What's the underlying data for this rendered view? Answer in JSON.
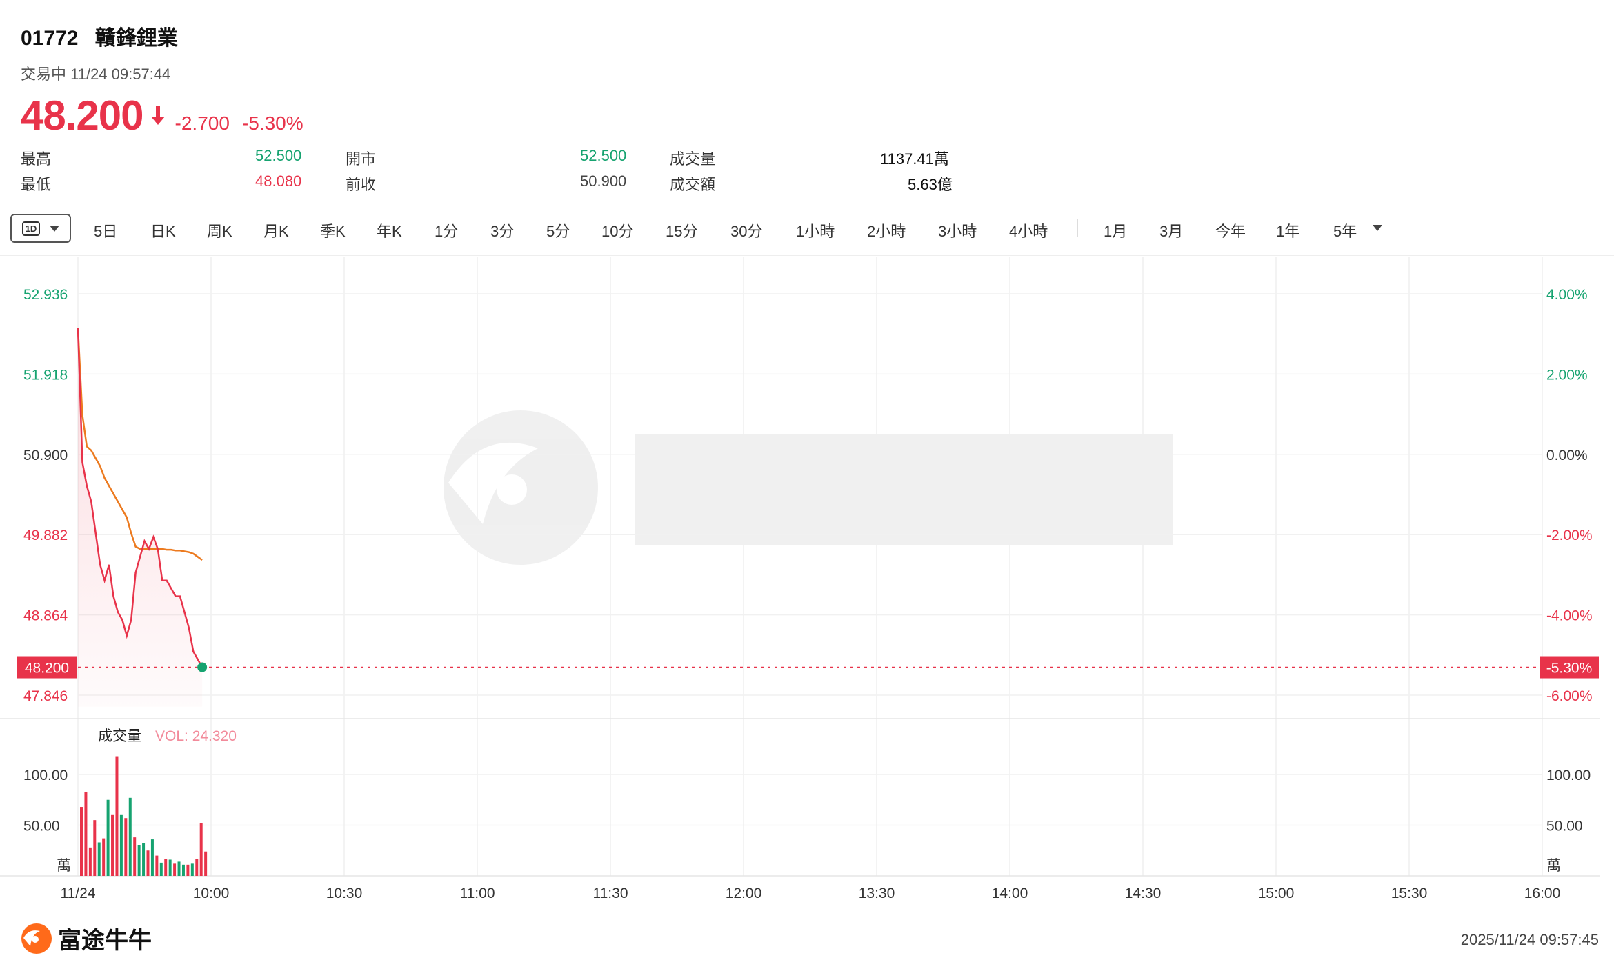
{
  "stock": {
    "code": "01772",
    "name": "贛鋒鋰業",
    "status": "交易中 11/24 09:57:44",
    "price": "48.200",
    "change": "-2.700",
    "change_pct": "-5.30%"
  },
  "stats": {
    "high_label": "最高",
    "high": "52.500",
    "low_label": "最低",
    "low": "48.080",
    "open_label": "開市",
    "open": "52.500",
    "prev_label": "前收",
    "prev": "50.900",
    "vol_label": "成交量",
    "vol": "1137.41萬",
    "amt_label": "成交額",
    "amt": "5.63億"
  },
  "toolbar": {
    "period_badge": "1D",
    "tabs": [
      "5日",
      "日K",
      "周K",
      "月K",
      "季K",
      "年K",
      "1分",
      "3分",
      "5分",
      "10分",
      "15分",
      "30分",
      "1小時",
      "2小時",
      "3小時",
      "4小時"
    ],
    "range_tabs": [
      "1月",
      "3月",
      "今年",
      "1年",
      "5年"
    ]
  },
  "chart_data": [
    {
      "type": "line",
      "prev_close": 50.9,
      "last_price": 48.2,
      "last_price_label": "48.200",
      "last_pct_label": "-5.30%",
      "ylim": [
        47.7,
        53.2
      ],
      "y_ticks": [
        "52.936",
        "51.918",
        "50.900",
        "49.882",
        "48.864",
        "47.846"
      ],
      "y_tick_values": [
        52.936,
        51.918,
        50.9,
        49.882,
        48.864,
        47.846
      ],
      "pct_ticks": [
        "4.00%",
        "2.00%",
        "0.00%",
        "-2.00%",
        "-4.00%",
        "-6.00%"
      ],
      "x_ticks": [
        "11/24",
        "10:00",
        "10:30",
        "11:00",
        "11:30",
        "12:00",
        "13:30",
        "14:00",
        "14:30",
        "15:00",
        "15:30",
        "16:00"
      ],
      "series": [
        {
          "kind": "price",
          "color": "#e8334a",
          "x_minutes": [
            0,
            1,
            2,
            3,
            4,
            5,
            6,
            7,
            8,
            9,
            10,
            11,
            12,
            13,
            14,
            15,
            16,
            17,
            18,
            19,
            20,
            21,
            22,
            23,
            24,
            25,
            26,
            27,
            28
          ],
          "values": [
            52.5,
            50.8,
            50.5,
            50.3,
            49.9,
            49.5,
            49.3,
            49.5,
            49.1,
            48.9,
            48.8,
            48.6,
            48.8,
            49.4,
            49.6,
            49.8,
            49.7,
            49.85,
            49.7,
            49.3,
            49.3,
            49.2,
            49.1,
            49.1,
            48.9,
            48.7,
            48.4,
            48.3,
            48.2
          ]
        },
        {
          "kind": "average",
          "color": "#ec7a1f",
          "x_minutes": [
            0,
            1,
            2,
            3,
            4,
            5,
            6,
            7,
            8,
            9,
            10,
            11,
            12,
            13,
            14,
            15,
            16,
            17,
            18,
            19,
            20,
            21,
            22,
            23,
            24,
            25,
            26,
            27,
            28
          ],
          "values": [
            52.5,
            51.4,
            51.0,
            50.95,
            50.85,
            50.75,
            50.6,
            50.5,
            50.4,
            50.3,
            50.2,
            50.1,
            49.9,
            49.73,
            49.7,
            49.7,
            49.7,
            49.7,
            49.7,
            49.7,
            49.69,
            49.69,
            49.68,
            49.68,
            49.67,
            49.66,
            49.64,
            49.6,
            49.56
          ]
        }
      ]
    },
    {
      "type": "bar",
      "title": "成交量",
      "vol_label": "VOL: 24.320",
      "ylim": [
        0,
        130
      ],
      "y_ticks": [
        "100.00",
        "50.00"
      ],
      "y_tick_values": [
        100,
        50
      ],
      "unit": "萬",
      "x_minutes": [
        0,
        1,
        2,
        3,
        4,
        5,
        6,
        7,
        8,
        9,
        10,
        11,
        12,
        13,
        14,
        15,
        16,
        17,
        18,
        19,
        20,
        21,
        22,
        23,
        24,
        25,
        26,
        27,
        28
      ],
      "values": [
        68,
        83,
        28,
        55,
        33,
        37,
        75,
        60,
        118,
        60,
        57,
        77,
        38,
        30,
        32,
        25,
        36,
        20,
        13,
        17,
        16,
        12,
        14,
        11,
        11,
        12,
        17,
        52,
        24
      ],
      "directions": [
        "down",
        "down",
        "down",
        "down",
        "up",
        "down",
        "up",
        "down",
        "down",
        "up",
        "down",
        "up",
        "down",
        "up",
        "up",
        "down",
        "up",
        "down",
        "up",
        "down",
        "up",
        "down",
        "up",
        "up",
        "down",
        "up",
        "down",
        "down",
        "down"
      ],
      "up_color": "#16a370",
      "down_color": "#e8334a"
    }
  ],
  "footer": {
    "logo_text": "富途牛牛",
    "timestamp": "2025/11/24 09:57:45"
  }
}
